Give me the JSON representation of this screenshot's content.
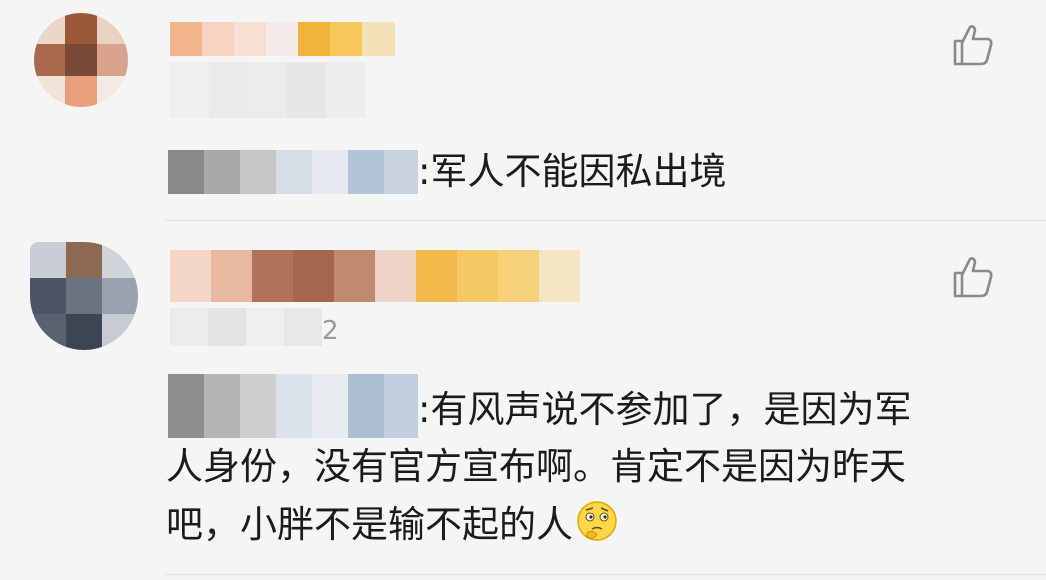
{
  "comments": [
    {
      "reply_text": ":军人不能因私出境",
      "like_icon": "thumbs-up-icon"
    },
    {
      "sub_suffix": "2",
      "reply_lines": [
        ":有风声说不参加了，是因为军",
        "人身份，没有官方宣布啊。肯定不是因为昨天",
        "吧，小胖不是输不起的人"
      ],
      "emoji": "thinking-face-emoji",
      "like_icon": "thumbs-up-icon"
    }
  ],
  "colors": {
    "background": "#f5f5f5",
    "text": "#1b1b1b",
    "icon": "#8a8a8a",
    "badge": "#f5b731"
  }
}
